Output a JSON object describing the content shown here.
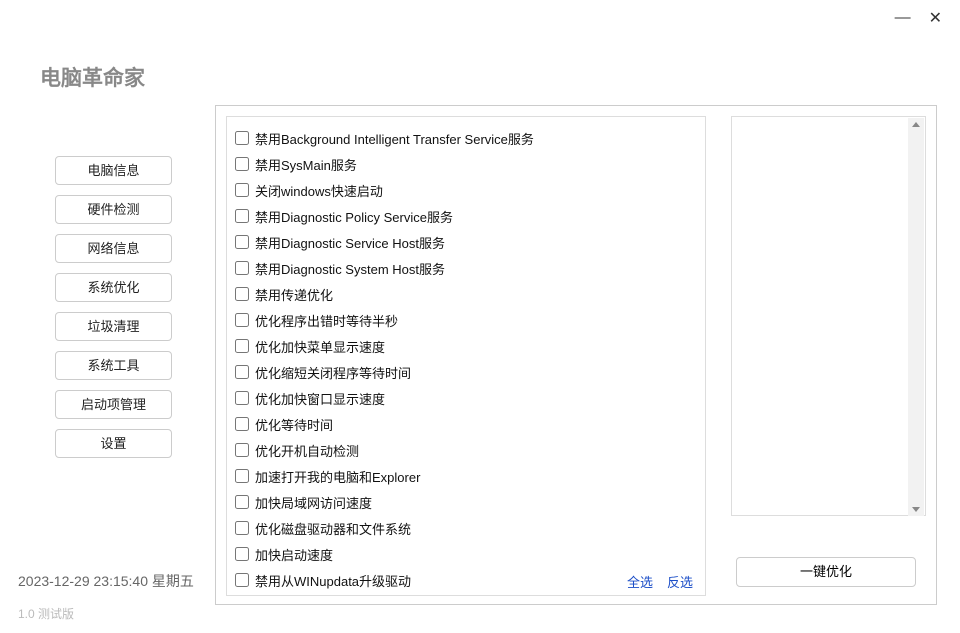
{
  "app_title": "电脑革命家",
  "window_controls": {
    "minimize": "—",
    "close": "✕"
  },
  "sidebar": {
    "items": [
      {
        "label": "电脑信息"
      },
      {
        "label": "硬件检测"
      },
      {
        "label": "网络信息"
      },
      {
        "label": "系统优化"
      },
      {
        "label": "垃圾清理"
      },
      {
        "label": "系统工具"
      },
      {
        "label": "启动项管理"
      },
      {
        "label": "设置"
      }
    ]
  },
  "options": [
    {
      "label": "禁用Background Intelligent Transfer Service服务"
    },
    {
      "label": "禁用SysMain服务"
    },
    {
      "label": "关闭windows快速启动"
    },
    {
      "label": "禁用Diagnostic Policy Service服务"
    },
    {
      "label": "禁用Diagnostic Service Host服务"
    },
    {
      "label": "禁用Diagnostic System Host服务"
    },
    {
      "label": "禁用传递优化"
    },
    {
      "label": "优化程序出错时等待半秒"
    },
    {
      "label": "优化加快菜单显示速度"
    },
    {
      "label": "优化缩短关闭程序等待时间"
    },
    {
      "label": "优化加快窗口显示速度"
    },
    {
      "label": "优化等待时间"
    },
    {
      "label": "优化开机自动检测"
    },
    {
      "label": "加速打开我的电脑和Explorer"
    },
    {
      "label": "加快局域网访问速度"
    },
    {
      "label": "优化磁盘驱动器和文件系统"
    },
    {
      "label": "加快启动速度"
    },
    {
      "label": "禁用从WINupdata升级驱动"
    }
  ],
  "actions": {
    "select_all": "全选",
    "invert_selection": "反选",
    "optimize": "一键优化"
  },
  "footer": {
    "datetime": "2023-12-29 23:15:40  星期五",
    "version": "1.0 测试版"
  }
}
